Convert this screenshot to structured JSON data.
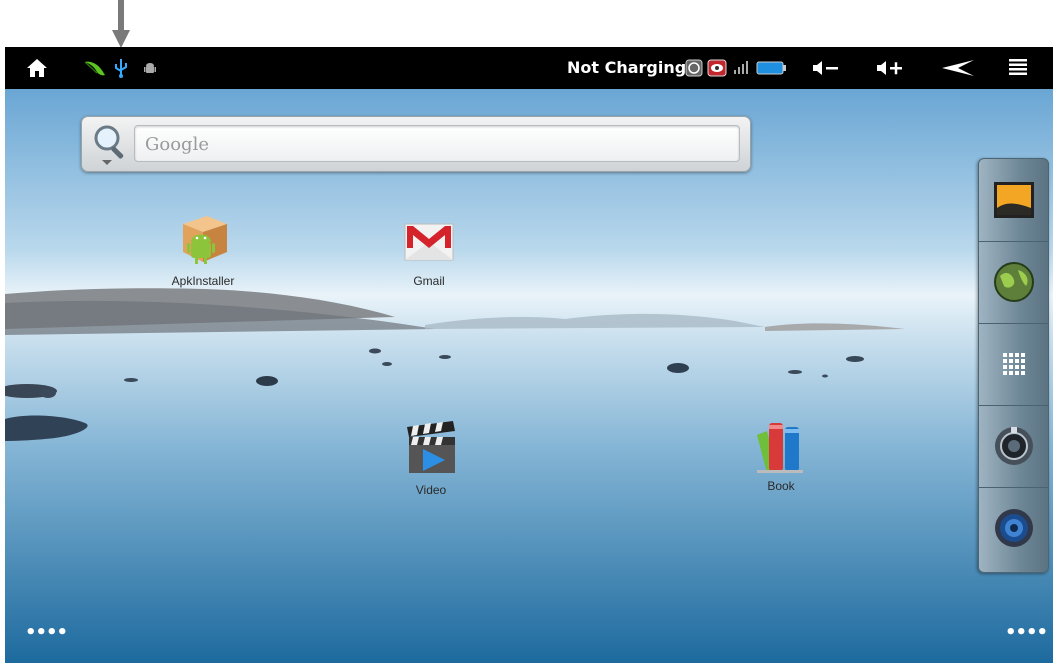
{
  "status_bar": {
    "charging_text": "Not Charging",
    "icons": [
      "home-icon",
      "leaf-icon",
      "usb-icon",
      "android-debug-icon",
      "screen-rotate-icon",
      "eye-icon",
      "signal-icon",
      "battery-icon",
      "volume-down-icon",
      "volume-up-icon",
      "back-icon",
      "menu-icon"
    ]
  },
  "search": {
    "placeholder": "Google"
  },
  "apps": [
    {
      "label": "ApkInstaller"
    },
    {
      "label": "Gmail"
    },
    {
      "label": "Video"
    },
    {
      "label": "Book"
    }
  ],
  "dock": [
    "gallery-icon",
    "browser-globe-icon",
    "app-drawer-icon",
    "camera-icon",
    "music-speaker-icon"
  ],
  "page_indicators": {
    "left": "••••",
    "right": "••••"
  }
}
